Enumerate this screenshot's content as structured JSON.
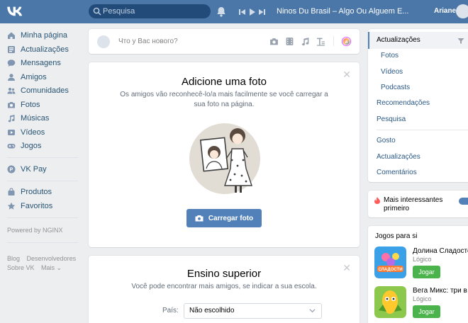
{
  "header": {
    "logo": "vk-logo",
    "search_placeholder": "Pesquisa",
    "track": "Ninos Du Brasil – Algo Ou Alguem E...",
    "username": "Ariane"
  },
  "leftnav": {
    "items": [
      {
        "label": "Minha página",
        "icon": "home-icon"
      },
      {
        "label": "Actualizações",
        "icon": "news-icon"
      },
      {
        "label": "Mensagens",
        "icon": "messages-icon"
      },
      {
        "label": "Amigos",
        "icon": "friends-icon"
      },
      {
        "label": "Comunidades",
        "icon": "communities-icon"
      },
      {
        "label": "Fotos",
        "icon": "camera-icon"
      },
      {
        "label": "Músicas",
        "icon": "music-icon"
      },
      {
        "label": "Vídeos",
        "icon": "video-icon"
      },
      {
        "label": "Jogos",
        "icon": "gamepad-icon"
      }
    ],
    "vkpay": "VK Pay",
    "items2": [
      {
        "label": "Produtos",
        "icon": "bag-icon"
      },
      {
        "label": "Favoritos",
        "icon": "star-icon"
      }
    ],
    "powered": "Powered by NGINX",
    "footer": {
      "blog": "Blog",
      "dev": "Desenvolvedores",
      "about": "Sobre VK",
      "more": "Mais ⌄"
    }
  },
  "post_box": {
    "placeholder": "Что у Вас нового?"
  },
  "photo_card": {
    "title": "Adicione uma foto",
    "subtitle": "Os amigos vão reconhecê-lo/a mais facilmente se você carregar a sua foto na página.",
    "button": "Carregar foto"
  },
  "edu_card": {
    "title": "Ensino superior",
    "subtitle": "Você pode encontrar mais amigos, se indicar a sua escola.",
    "country_label": "País:",
    "country_value": "Não escolhido"
  },
  "right_nav": {
    "active": "Actualizações",
    "sub": [
      "Fotos",
      "Vídeos",
      "Podcasts"
    ],
    "group1": [
      "Recomendações",
      "Pesquisa"
    ],
    "group2": [
      "Gosto",
      "Actualizações",
      "Comentários"
    ]
  },
  "interest": {
    "label": "Mais interessantes primeiro",
    "enabled": true
  },
  "games": {
    "title": "Jogos para si",
    "items": [
      {
        "name": "Долина Сладостей",
        "category": "Lógico",
        "button": "Jogar",
        "thumb_color": "#3aa0e8"
      },
      {
        "name": "Вега Микс: три в ряд",
        "category": "Lógico",
        "button": "Jogar",
        "thumb_color": "#8cc84b"
      }
    ]
  },
  "colors": {
    "header": "#4a76a8",
    "accent": "#5181b8",
    "link": "#2a5885",
    "play": "#4bb34b"
  }
}
